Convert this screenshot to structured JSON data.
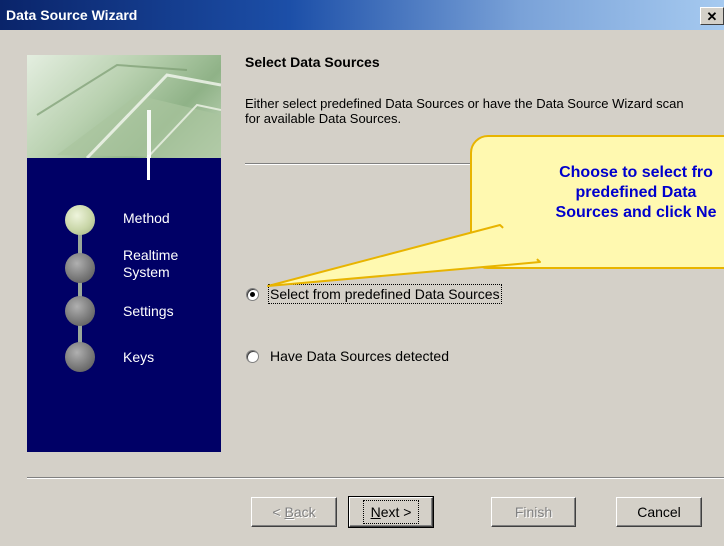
{
  "window": {
    "title": "Data Source Wizard",
    "close_glyph": "✕"
  },
  "sidebar": {
    "steps": [
      {
        "label": "Method",
        "active": true
      },
      {
        "label": "Realtime\nSystem",
        "active": false
      },
      {
        "label": "Settings",
        "active": false
      },
      {
        "label": "Keys",
        "active": false
      }
    ]
  },
  "page": {
    "heading": "Select Data Sources",
    "description": "Either select predefined Data Sources or have the Data Source Wizard scan for available Data Sources."
  },
  "options": {
    "predefined": {
      "label": "Select from predefined Data Sources",
      "checked": true
    },
    "detected": {
      "label": "Have Data Sources detected",
      "checked": false
    }
  },
  "callout": {
    "text": "Choose to select fro\npredefined Data\nSources and click Ne"
  },
  "buttons": {
    "back": {
      "prefix": "< ",
      "accel": "B",
      "rest": "ack",
      "enabled": false
    },
    "next": {
      "accel": "N",
      "rest": "ext >",
      "enabled": true
    },
    "finish": {
      "label": "Finish",
      "enabled": false
    },
    "cancel": {
      "label": "Cancel",
      "enabled": true
    }
  },
  "colors": {
    "sidebar_bg": "#000066",
    "callout_fill": "#fff9b0",
    "callout_border": "#e8b400",
    "callout_text": "#0000cc"
  }
}
